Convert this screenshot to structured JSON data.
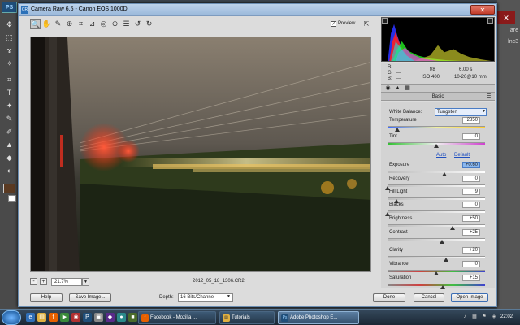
{
  "photoshop": {
    "logo": "PS",
    "right_labels": [
      "are",
      "lnc3"
    ]
  },
  "dialog": {
    "title": "Camera Raw 6.5  -  Canon EOS 1000D",
    "close": "✕"
  },
  "toolbar": {
    "tools": [
      {
        "icon": "zoom-tool-icon",
        "glyph": "🔍"
      },
      {
        "icon": "hand-tool-icon",
        "glyph": "✋"
      },
      {
        "icon": "white-balance-tool-icon",
        "glyph": "✎"
      },
      {
        "icon": "color-sampler-icon",
        "glyph": "⊕"
      },
      {
        "icon": "crop-tool-icon",
        "glyph": "⌗"
      },
      {
        "icon": "straighten-tool-icon",
        "glyph": "⊿"
      },
      {
        "icon": "retouch-tool-icon",
        "glyph": "◎"
      },
      {
        "icon": "red-eye-icon",
        "glyph": "⊙"
      },
      {
        "icon": "preferences-icon",
        "glyph": "☰"
      },
      {
        "icon": "rotate-ccw-icon",
        "glyph": "↺"
      },
      {
        "icon": "rotate-cw-icon",
        "glyph": "↻"
      }
    ],
    "preview_label": "Preview",
    "preview_checked": "✓",
    "fullscreen_glyph": "⇱"
  },
  "zoom": {
    "minus": "-",
    "plus": "+",
    "value": "21.7%",
    "arrow": "▼"
  },
  "filename": "2012_05_18_1306.CR2",
  "readout": {
    "r_label": "R:",
    "g_label": "G:",
    "b_label": "B:",
    "r_value": "---",
    "g_value": "---",
    "b_value": "---",
    "aperture": "f/8",
    "shutter": "6.00 s",
    "iso": "ISO 400",
    "lens": "10-20@10 mm"
  },
  "panel": {
    "tabs": [
      "◉",
      "▲",
      "▦"
    ],
    "name": "Basic",
    "menu": "☰",
    "white_balance_label": "White Balance:",
    "white_balance_value": "Tungsten",
    "auto": "Auto",
    "default": "Default",
    "sliders": [
      {
        "label": "Temperature",
        "value": "2850",
        "position": 0.1
      },
      {
        "label": "Tint",
        "value": "0",
        "position": 0.5
      },
      {
        "label": "Exposure",
        "value": "+0.60",
        "position": 0.58,
        "focus": true
      },
      {
        "label": "Recovery",
        "value": "0",
        "position": 0.0
      },
      {
        "label": "Fill Light",
        "value": "9",
        "position": 0.09
      },
      {
        "label": "Blacks",
        "value": "0",
        "position": 0.0
      },
      {
        "label": "Brightness",
        "value": "+50",
        "position": 0.67
      },
      {
        "label": "Contrast",
        "value": "+25",
        "position": 0.56
      },
      {
        "label": "Clarity",
        "value": "+20",
        "position": 0.6
      },
      {
        "label": "Vibrance",
        "value": "0",
        "position": 0.5
      },
      {
        "label": "Saturation",
        "value": "+15",
        "position": 0.57
      }
    ]
  },
  "buttons": {
    "help": "Help",
    "save_image": "Save Image...",
    "depth_label": "Depth:",
    "depth_value": "16 Bits/Channel",
    "done": "Done",
    "cancel": "Cancel",
    "open_image": "Open Image"
  },
  "taskbar": {
    "tasks": [
      {
        "label": "Facebook - Mozilla ...",
        "icon": "firefox-icon",
        "glyph": "f",
        "color": "#e66000"
      },
      {
        "label": "Tutorials",
        "icon": "folder-icon",
        "glyph": "▤",
        "color": "#e0b040"
      },
      {
        "label": "Adobe Photoshop E...",
        "icon": "photoshop-icon",
        "glyph": "Ps",
        "color": "#1f4e79",
        "active": true
      }
    ],
    "clock": "22:02"
  },
  "colors": {
    "accent": "#4a7cc4",
    "dialog_bg": "#dcdcdc",
    "panel_bg": "#d3d3d3"
  }
}
